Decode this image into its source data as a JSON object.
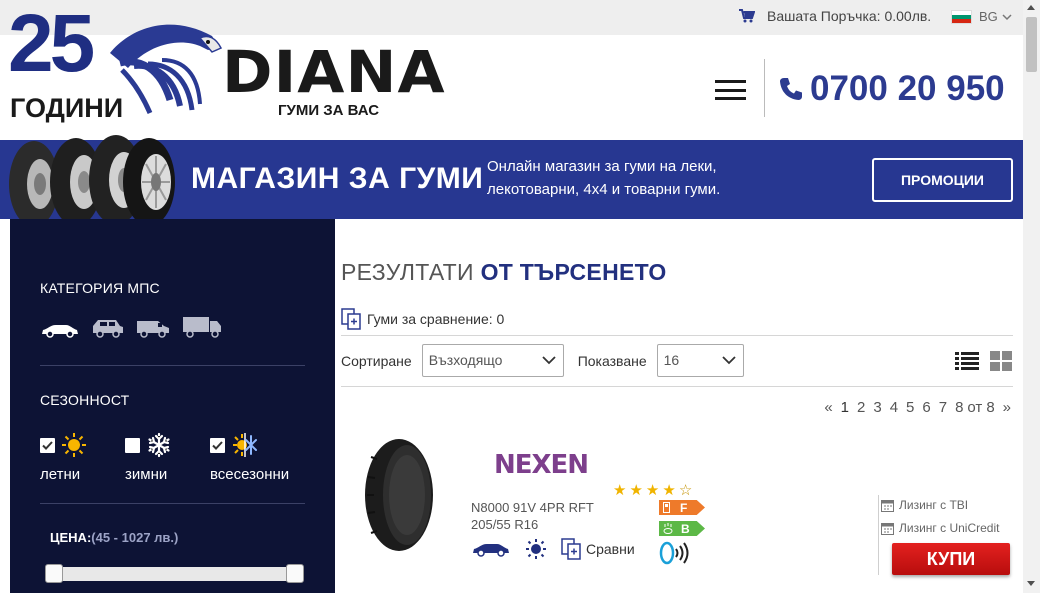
{
  "topbar": {
    "cart_label": "Вашата Поръчка: 0.00лв.",
    "lang": "BG",
    "cart_icon": "shopping-cart-icon"
  },
  "header": {
    "logo_number": "25",
    "logo_years": "ГОДИНИ",
    "logo_name": "DIANA",
    "logo_tagline": "ГУМИ ЗА ВАС",
    "phone": "0700 20 950"
  },
  "banner": {
    "title": "МАГАЗИН ЗА ГУМИ",
    "desc_line1": "Онлайн магазин за гуми на леки,",
    "desc_line2": "лекотоварни, 4x4 и товарни гуми.",
    "promo_button": "ПРОМОЦИИ"
  },
  "sidebar": {
    "category_heading": "КАТЕГОРИЯ МПС",
    "vehicles": [
      "car-icon",
      "suv-icon",
      "van-icon",
      "truck-icon"
    ],
    "season_heading": "СЕЗОННОСТ",
    "seasons": [
      {
        "label": "летни",
        "checked": true,
        "icon": "sun-icon"
      },
      {
        "label": "зимни",
        "checked": false,
        "icon": "snowflake-icon"
      },
      {
        "label": "всесезонни",
        "checked": true,
        "icon": "all-season-icon"
      }
    ],
    "price_label": "ЦЕНА:",
    "price_range": "(45 - 1027 лв.)",
    "price_min": 45,
    "price_max": 1027
  },
  "results": {
    "title_light": "РЕЗУЛТАТИ",
    "title_bold": "ОТ ТЪРСЕНЕТО",
    "compare_label": "Гуми за сравнение: 0",
    "sort_label": "Сортиране",
    "sort_value": "Възходящо",
    "show_label": "Показване",
    "show_value": "16",
    "pager": {
      "first": "«",
      "pages": [
        "1",
        "2",
        "3",
        "4",
        "5",
        "6",
        "7",
        "8"
      ],
      "of": "от",
      "total": "8",
      "last": "»",
      "current": "1"
    }
  },
  "product": {
    "brand": "NEXEN",
    "name_line1": "N8000 91V 4PR RFT",
    "name_line2": "205/55 R16",
    "rating": 4,
    "rating_max": 5,
    "fuel_class": "F",
    "wet_class": "B",
    "fuel_color": "#ee7a2a",
    "wet_color": "#5cb846",
    "compare": "Сравни",
    "lease_tbi": "Лизинг с TBI",
    "lease_unicredit": "Лизинг с UniCredit",
    "buy": "КУПИ"
  },
  "colors": {
    "brand_blue": "#273791",
    "sidebar_bg": "#0d1335",
    "buy_red": "#d41a17"
  }
}
